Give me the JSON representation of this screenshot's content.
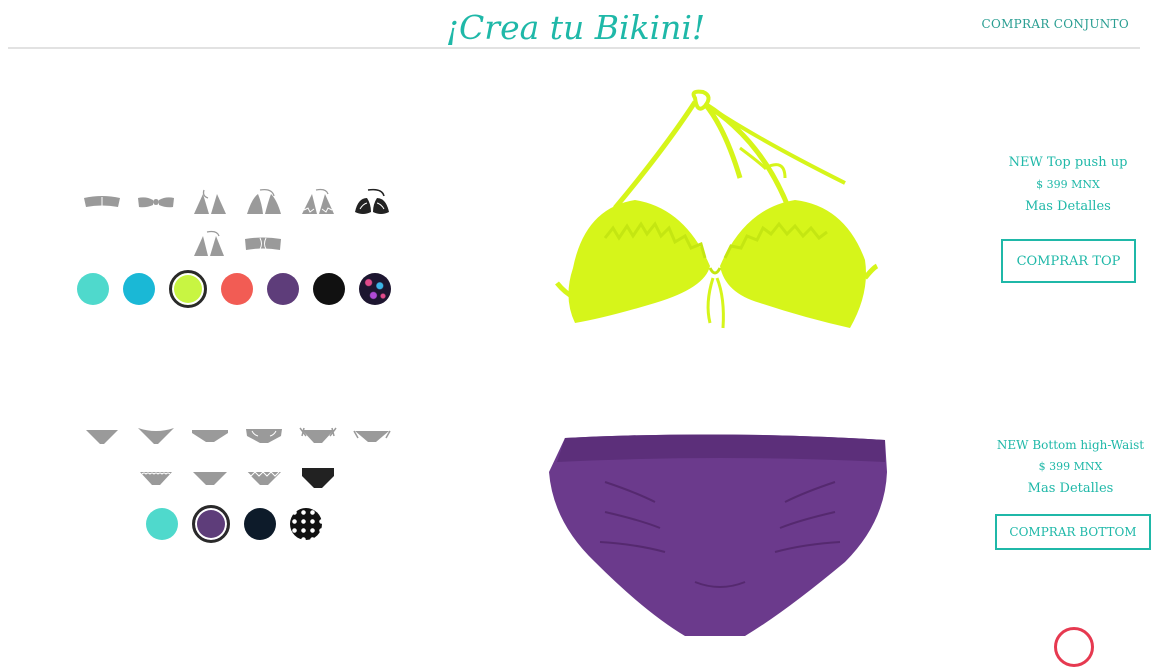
{
  "header": {
    "title": "¡Crea tu Bikini!",
    "buy_set_label": "COMPRAR CONJUNTO"
  },
  "top": {
    "styles": [
      "bandeau",
      "bandeau-knot",
      "triangle",
      "triangle-padded",
      "triangle-ruffle",
      "push-up-halter",
      "triangle-halter",
      "bandeau-twist"
    ],
    "selected_style": "push-up-halter",
    "swatches": [
      "#4fd9cc",
      "#1ab8d6",
      "#c8f542",
      "#f25c54",
      "#5e3d7a",
      "#111111",
      "pattern-floral"
    ],
    "selected_swatch": 2,
    "product_color": "#d6f51a",
    "name": "NEW Top push up",
    "price": "$ 399 MNX",
    "details_label": "Mas Detalles",
    "buy_label": "COMPRAR TOP"
  },
  "bottom": {
    "styles": [
      "hipster",
      "thong",
      "brazilian",
      "ruched",
      "tie-side-ruffle",
      "tie-side",
      "scallop",
      "classic",
      "lace-edge",
      "high-waist"
    ],
    "selected_style": "high-waist",
    "swatches": [
      "#4fd9cc",
      "#5e3d7a",
      "#0d1b2a",
      "pattern-dots"
    ],
    "selected_swatch": 1,
    "product_color": "#6b3a8c",
    "name": "NEW Bottom high-Waist",
    "price": "$ 399 MNX",
    "details_label": "Mas Detalles",
    "buy_label": "COMPRAR BOTTOM"
  },
  "colors": {
    "accent": "#1fb8a8",
    "icon_gray": "#9a9a9a",
    "icon_selected": "#222222"
  }
}
